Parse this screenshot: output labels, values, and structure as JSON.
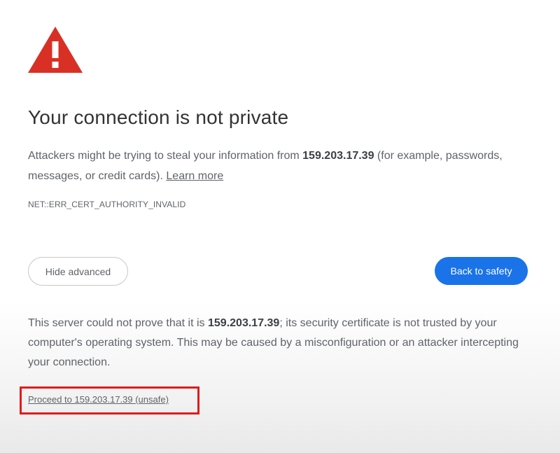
{
  "icon": "warning-triangle-icon",
  "title": "Your connection is not private",
  "message": {
    "part1": "Attackers might be trying to steal your information from ",
    "host": "159.203.17.39",
    "part2": " (for example, passwords, messages, or credit cards). ",
    "learn_more": "Learn more"
  },
  "error_code": "NET::ERR_CERT_AUTHORITY_INVALID",
  "buttons": {
    "hide_advanced": "Hide advanced",
    "back_to_safety": "Back to safety"
  },
  "details": {
    "part1": "This server could not prove that it is ",
    "host": "159.203.17.39",
    "part2": "; its security certificate is not trusted by your computer's operating system. This may be caused by a misconfiguration or an attacker intercepting your connection."
  },
  "proceed_link": "Proceed to 159.203.17.39 (unsafe)",
  "colors": {
    "warning_red": "#d93025",
    "primary_blue": "#1a73e8",
    "highlight_box": "#e01b1b"
  }
}
